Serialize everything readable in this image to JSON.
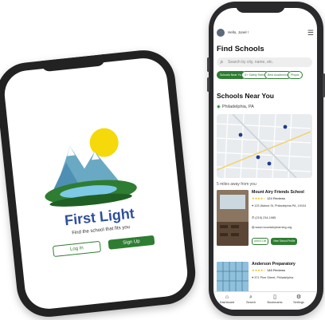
{
  "left_screen": {
    "brand_title": "First Light",
    "tagline": "Find the school that fits you",
    "login_label": "Log In",
    "signup_label": "Sign Up"
  },
  "right_screen": {
    "greeting": "Hello, Jonel !",
    "find_title": "Find Schools",
    "search_placeholder": "Search by city, name, etc.",
    "chips": [
      "Schools Near You",
      "A+ Safety Rating",
      "Best Academics",
      "Physic"
    ],
    "near_title": "Schools Near You",
    "location": "Philadelphia, PA",
    "miles_text": "5 miles away from you",
    "cards": [
      {
        "name": "Mount Airy Friends School",
        "stars": "★★★★☆",
        "reviews": "124 Reviews",
        "address": "123 Walnut St, Philadelphia PA, 19104",
        "phone": "(215) 234-1985",
        "website": "www.mountairylearning.org",
        "button_secondary": "Add to List",
        "button_primary": "View School Profile"
      },
      {
        "name": "Anderson Preparatory",
        "stars": "★★★★☆",
        "reviews": "148 Reviews",
        "address": "371 Pine Street, Philadelphia"
      }
    ],
    "tabs": [
      {
        "label": "Dashboard",
        "icon": "home-icon",
        "glyph": "⌂"
      },
      {
        "label": "Search",
        "icon": "search-icon",
        "glyph": "⌕"
      },
      {
        "label": "Bookmarks",
        "icon": "bookmark-icon",
        "glyph": "▯"
      },
      {
        "label": "Settings",
        "icon": "gear-icon",
        "glyph": "⚙"
      }
    ]
  },
  "colors": {
    "brand_blue": "#2f4f9a",
    "brand_green": "#2e7d32",
    "sun_yellow": "#f5d90a",
    "map_pin": "#1f3b8c"
  }
}
